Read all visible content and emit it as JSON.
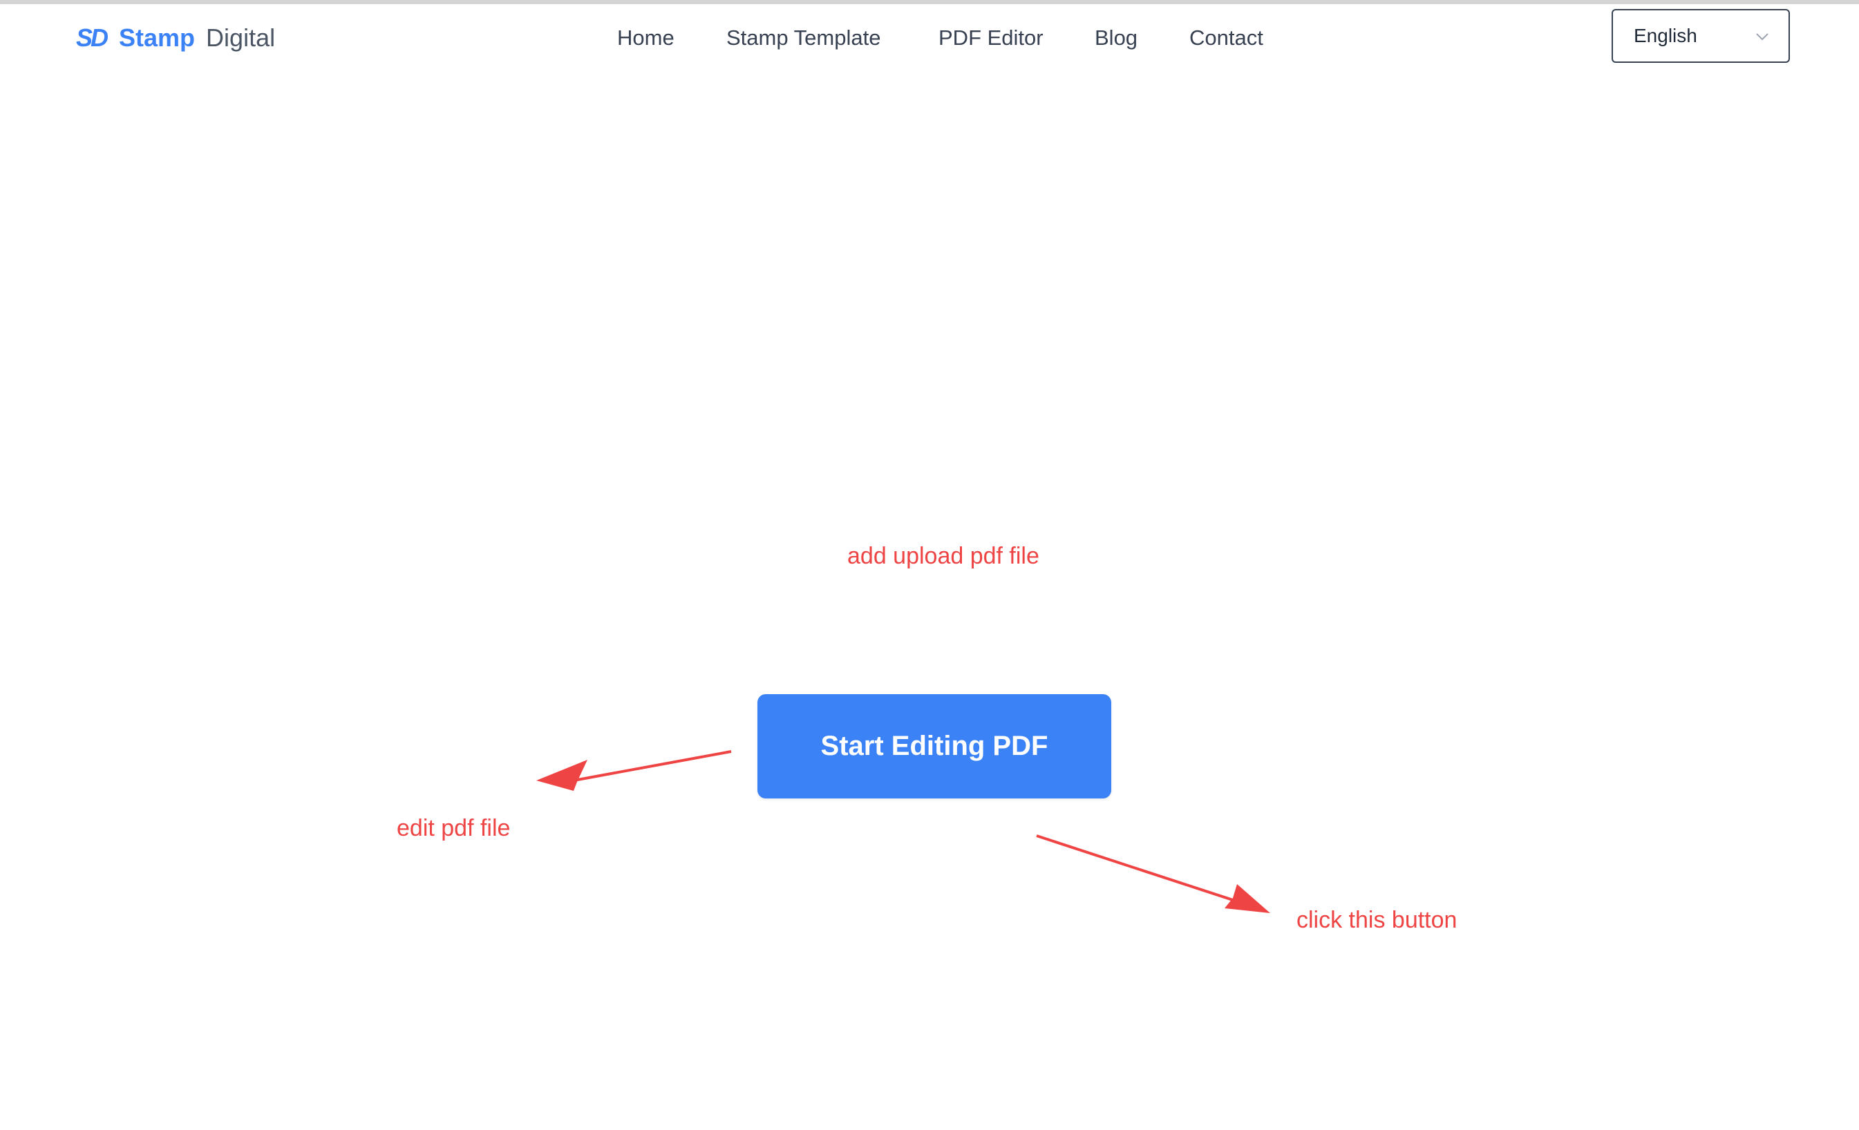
{
  "brand": {
    "mark": "SD",
    "name_primary": "Stamp",
    "name_secondary": "Digital"
  },
  "nav": {
    "items": [
      {
        "label": "Home"
      },
      {
        "label": "Stamp Template"
      },
      {
        "label": "PDF Editor"
      },
      {
        "label": "Blog"
      },
      {
        "label": "Contact"
      }
    ]
  },
  "language": {
    "selected": "English"
  },
  "main": {
    "start_button_label": "Start Editing PDF"
  },
  "annotations": {
    "upload_note": "add upload pdf file",
    "edit_note": "edit pdf file",
    "click_note": "click this button"
  },
  "colors": {
    "brand": "#3b82f6",
    "annotation": "#ef4444",
    "nav_text": "#374151"
  },
  "icons": {
    "language_dropdown": "chevron-down-icon",
    "annotation_arrows": "arrow-icon"
  }
}
